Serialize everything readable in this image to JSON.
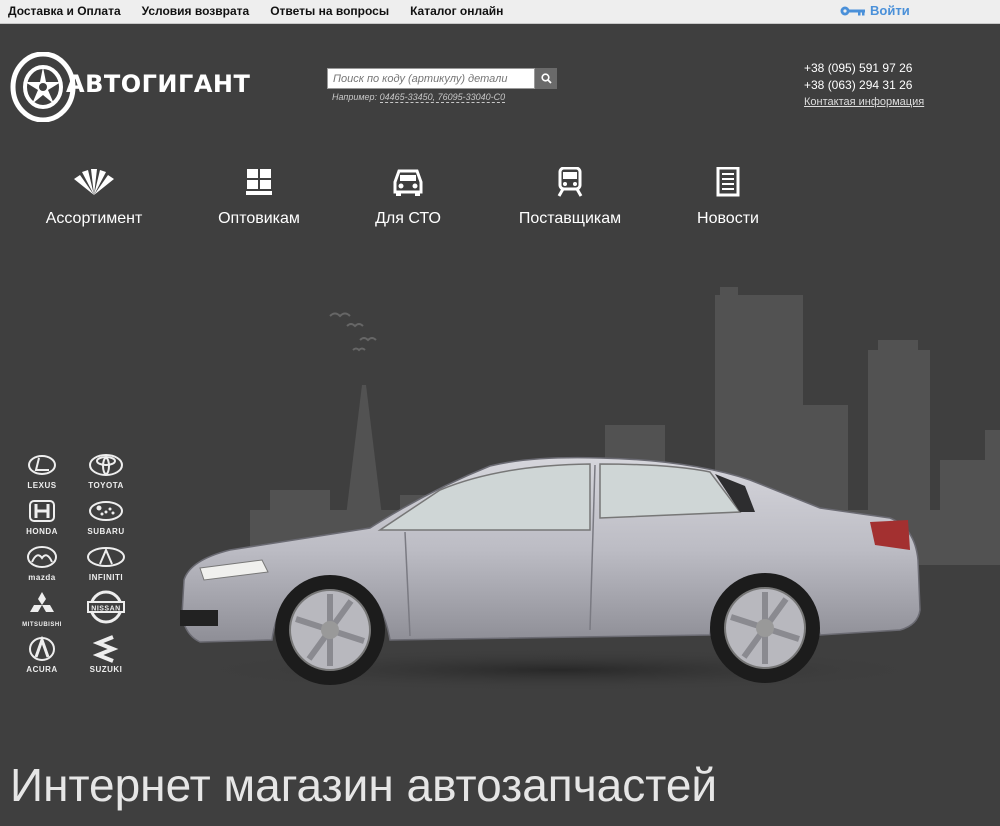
{
  "topbar": {
    "links": [
      "Доставка и Оплата",
      "Условия возврата",
      "Ответы на вопросы",
      "Каталог онлайн"
    ],
    "login_label": "Войти",
    "login_icon": "key-icon"
  },
  "header": {
    "logo_text": "АВТОГИГАНТ",
    "search_placeholder": "Поиск по коду (артикулу) детали",
    "example_prefix": "Например:",
    "example_codes": "04465-33450, 76095-33040-C0",
    "phones": [
      "+38 (095) 591 97 26",
      "+38 (063) 294 31 26"
    ],
    "contact_link": "Контактая информация"
  },
  "nav": {
    "items": [
      {
        "label": "Ассортимент",
        "icon": "fan-icon"
      },
      {
        "label": "Оптовикам",
        "icon": "boxes-icon"
      },
      {
        "label": "Для СТО",
        "icon": "car-front-icon"
      },
      {
        "label": "Поставщикам",
        "icon": "train-icon"
      },
      {
        "label": "Новости",
        "icon": "document-icon"
      }
    ]
  },
  "brands": [
    "LEXUS",
    "TOYOTA",
    "HONDA",
    "SUBARU",
    "mazda",
    "INFINITI",
    "MITSUBISHI",
    "NISSAN",
    "ACURA",
    "SUZUKI"
  ],
  "hero": {
    "tagline": "Интернет магазин автозапчастей"
  },
  "colors": {
    "background": "#3f3f3f",
    "topbar": "#eeeeee",
    "login_accent": "#4a90d9"
  }
}
